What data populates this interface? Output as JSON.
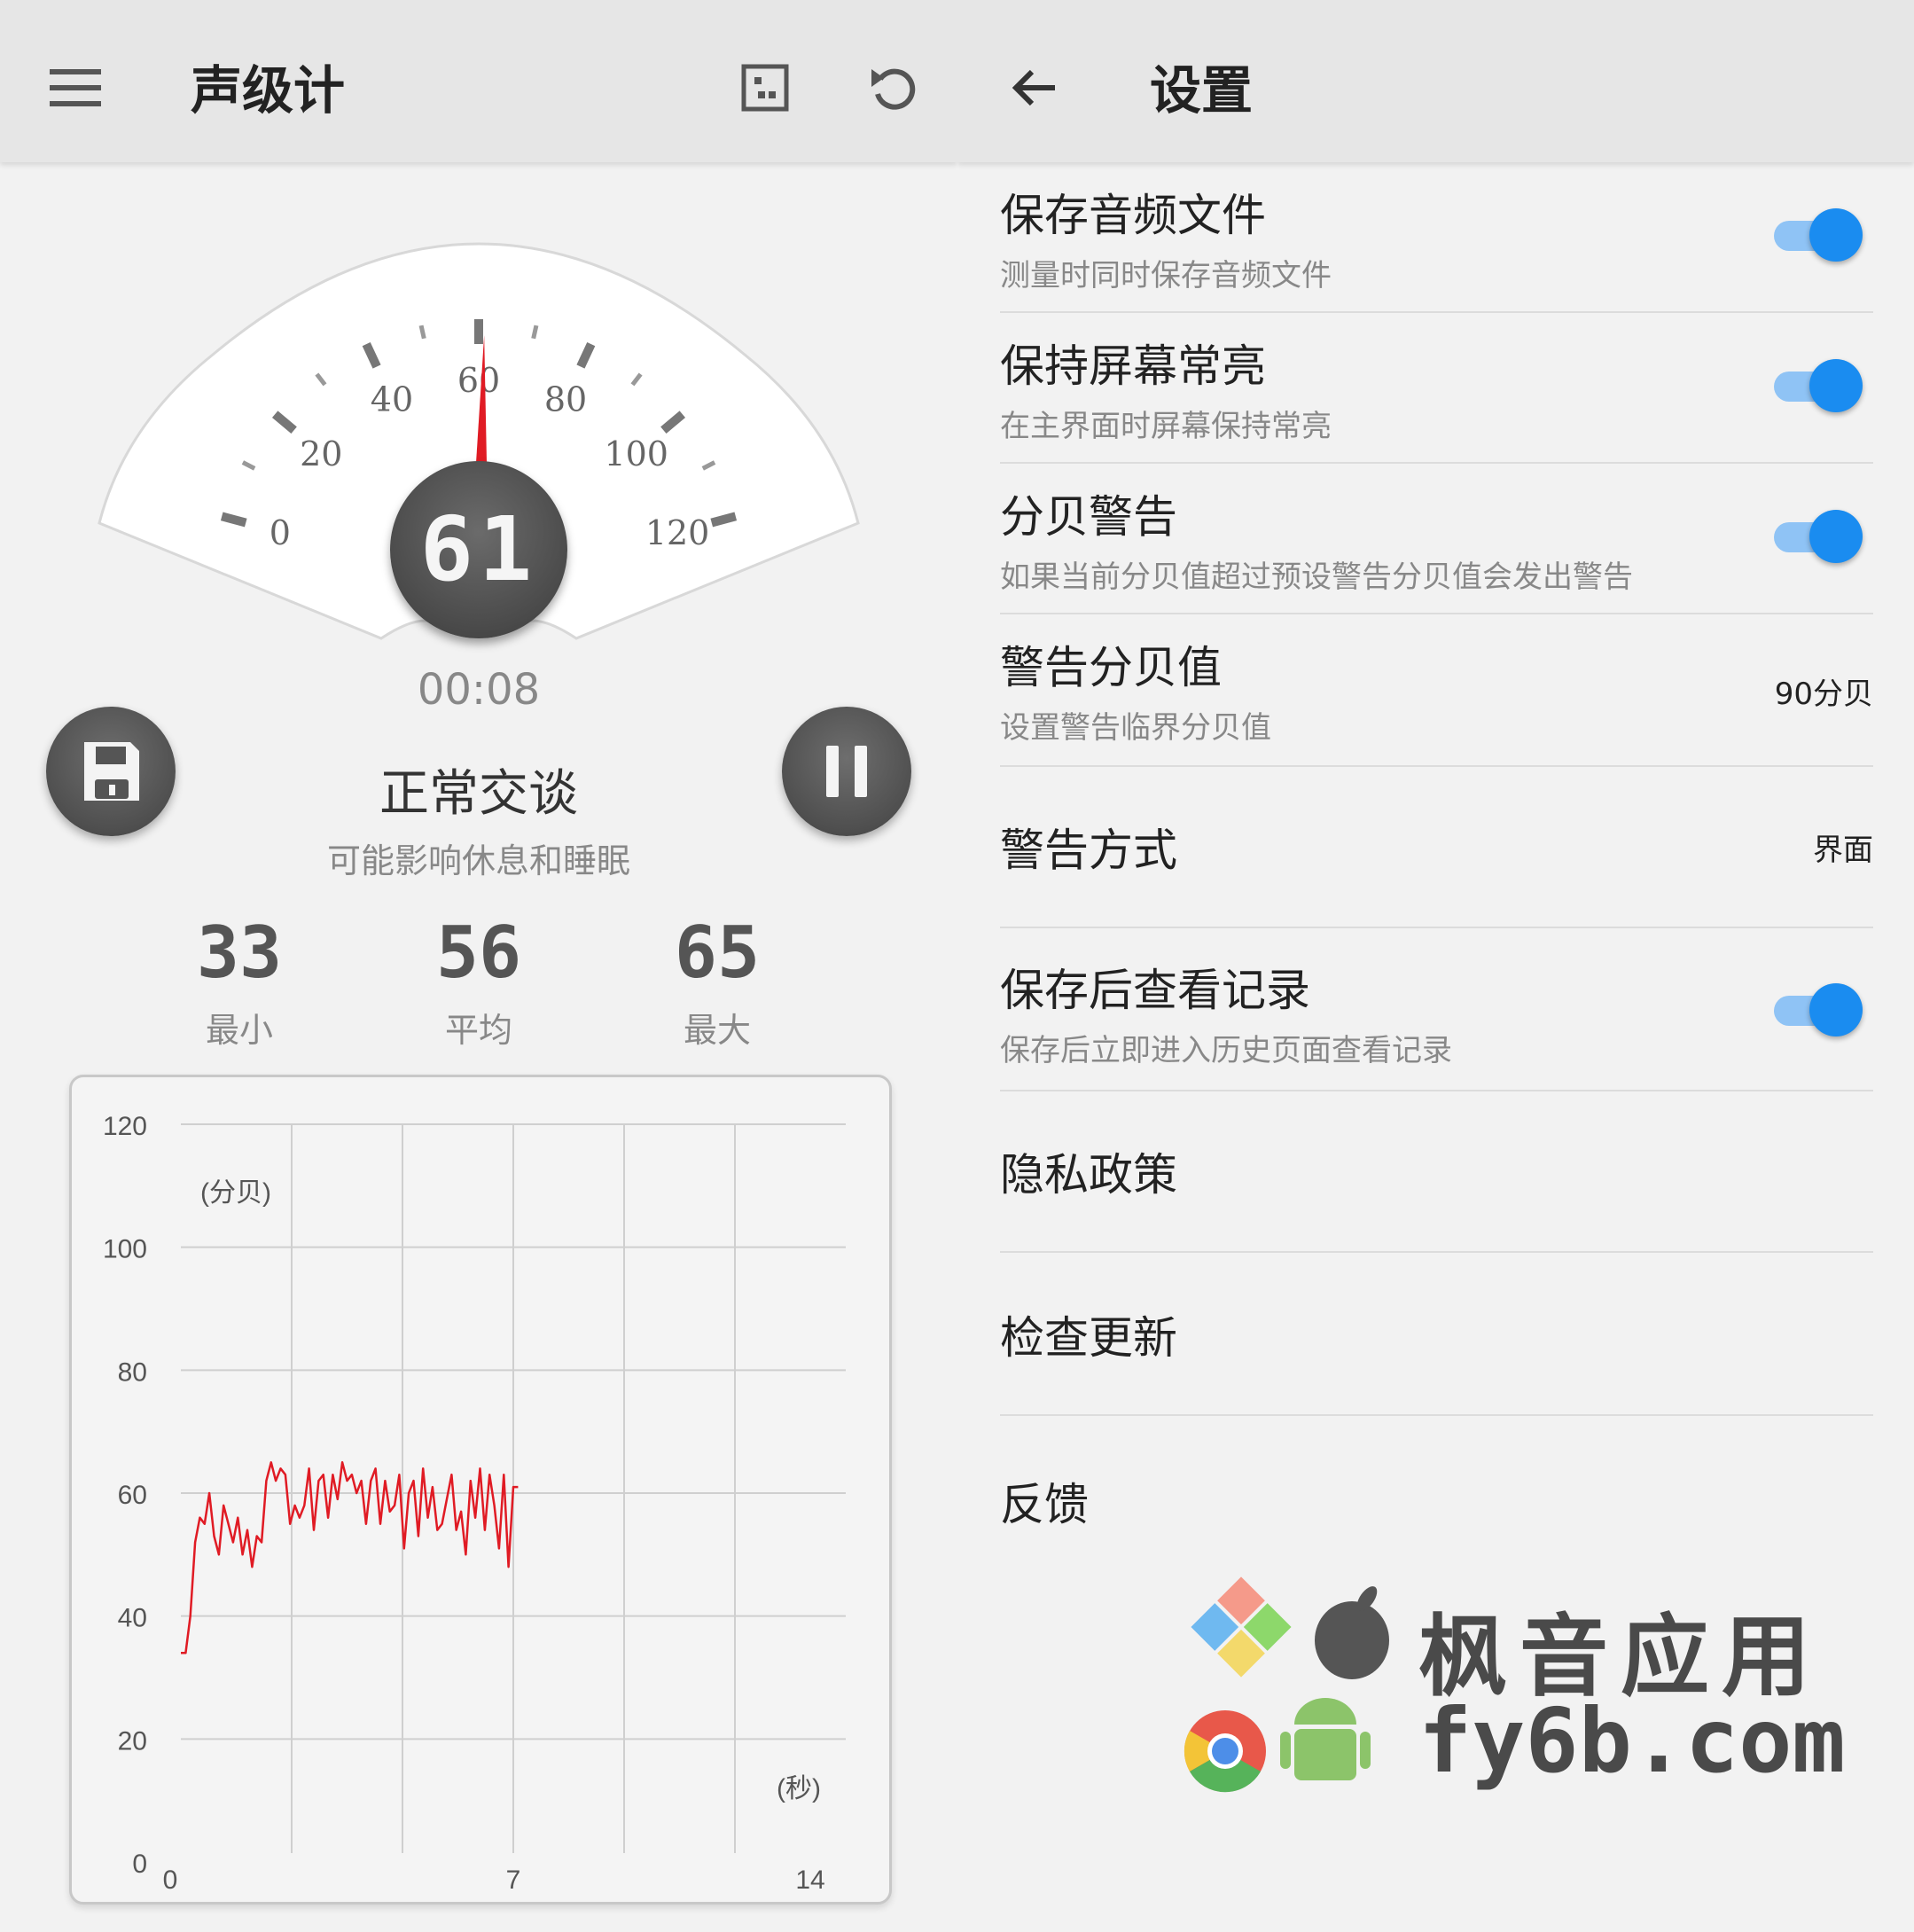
{
  "meter": {
    "title": "声级计",
    "gauge": {
      "scale_labels": [
        "0",
        "20",
        "40",
        "60",
        "80",
        "100",
        "120"
      ],
      "needle_value": 61,
      "display": "61"
    },
    "elapsed": "00:08",
    "level_title": "正常交谈",
    "level_desc": "可能影响休息和睡眠",
    "stats": [
      {
        "value": "33",
        "label": "最小"
      },
      {
        "value": "56",
        "label": "平均"
      },
      {
        "value": "65",
        "label": "最大"
      }
    ]
  },
  "settings": {
    "title": "设置",
    "items": [
      {
        "title": "保存音频文件",
        "subtitle": "测量时同时保存音频文件",
        "toggle": true
      },
      {
        "title": "保持屏幕常亮",
        "subtitle": "在主界面时屏幕保持常亮",
        "toggle": true
      },
      {
        "title": "分贝警告",
        "subtitle": "如果当前分贝值超过预设警告分贝值会发出警告",
        "toggle": true
      },
      {
        "title": "警告分贝值",
        "subtitle": "设置警告临界分贝值",
        "value": "90分贝"
      },
      {
        "title": "警告方式",
        "value": "界面"
      },
      {
        "title": "保存后查看记录",
        "subtitle": "保存后立即进入历史页面查看记录",
        "toggle": true
      },
      {
        "title": "隐私政策"
      },
      {
        "title": "检查更新"
      },
      {
        "title": "反馈"
      }
    ]
  },
  "watermark": {
    "brand": "枫音应用",
    "url": "fy6b.com"
  },
  "colors": {
    "needle": "#e01b24",
    "plot_line": "#e01b24",
    "toggle_on": "#1a8cf0",
    "toggle_track": "#8fc3f5"
  },
  "chart_data": {
    "type": "line",
    "ylabel": "(分贝)",
    "xlabel": "(秒)",
    "y_ticks": [
      "0",
      "20",
      "40",
      "60",
      "80",
      "100",
      "120"
    ],
    "x_ticks": [
      "0",
      "7",
      "14"
    ],
    "ylim": [
      0,
      120
    ],
    "xlim": [
      0,
      14
    ],
    "grid": true,
    "series": [
      {
        "x": [
          0,
          0.1,
          0.2,
          0.3,
          0.4,
          0.5,
          0.6,
          0.7,
          0.8,
          0.9,
          1.0,
          1.1,
          1.2,
          1.3,
          1.4,
          1.5,
          1.6,
          1.7,
          1.8,
          1.9,
          2.0,
          2.1,
          2.2,
          2.3,
          2.4,
          2.5,
          2.6,
          2.7,
          2.8,
          2.9,
          3.0,
          3.1,
          3.2,
          3.3,
          3.4,
          3.5,
          3.6,
          3.7,
          3.8,
          3.9,
          4.0,
          4.1,
          4.2,
          4.3,
          4.4,
          4.5,
          4.6,
          4.7,
          4.8,
          4.9,
          5.0,
          5.1,
          5.2,
          5.3,
          5.4,
          5.5,
          5.6,
          5.7,
          5.8,
          5.9,
          6.0,
          6.1,
          6.2,
          6.3,
          6.4,
          6.5,
          6.6,
          6.7,
          6.8,
          6.9,
          7.0,
          7.1
        ],
        "values": [
          34,
          34,
          40,
          52,
          56,
          55,
          60,
          53,
          50,
          58,
          55,
          52,
          56,
          50,
          54,
          48,
          53,
          52,
          62,
          65,
          62,
          64,
          63,
          55,
          58,
          56,
          58,
          64,
          54,
          62,
          63,
          56,
          63,
          59,
          65,
          62,
          63,
          60,
          62,
          55,
          62,
          64,
          55,
          62,
          57,
          58,
          63,
          51,
          60,
          62,
          53,
          64,
          56,
          61,
          54,
          55,
          59,
          63,
          54,
          57,
          50,
          62,
          56,
          64,
          54,
          63,
          58,
          51,
          63,
          48,
          61,
          61
        ]
      }
    ]
  }
}
